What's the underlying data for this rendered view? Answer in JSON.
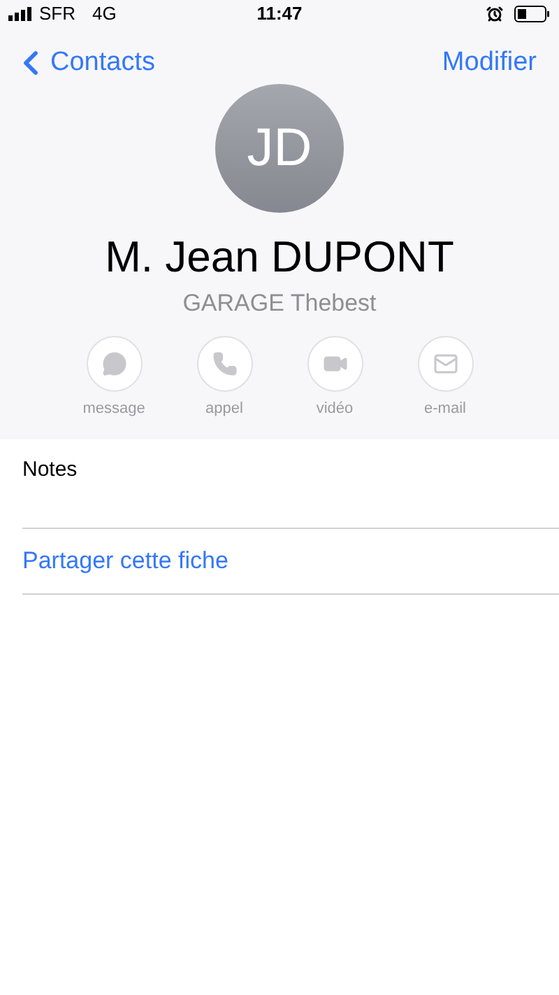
{
  "status_bar": {
    "carrier": "SFR",
    "network": "4G",
    "time": "11:47"
  },
  "nav": {
    "back": "Contacts",
    "edit": "Modifier"
  },
  "contact": {
    "initials": "JD",
    "name": "M. Jean DUPONT",
    "company": "GARAGE Thebest"
  },
  "actions": [
    {
      "kind": "message",
      "label": "message",
      "disabled": true
    },
    {
      "kind": "call",
      "label": "appel",
      "disabled": true
    },
    {
      "kind": "video",
      "label": "vidéo",
      "disabled": true
    },
    {
      "kind": "mail",
      "label": "e-mail",
      "disabled": true
    }
  ],
  "fields": [
    {
      "kind": "notes",
      "label": "Notes"
    },
    {
      "kind": "link",
      "label": "Partager cette fiche"
    }
  ]
}
